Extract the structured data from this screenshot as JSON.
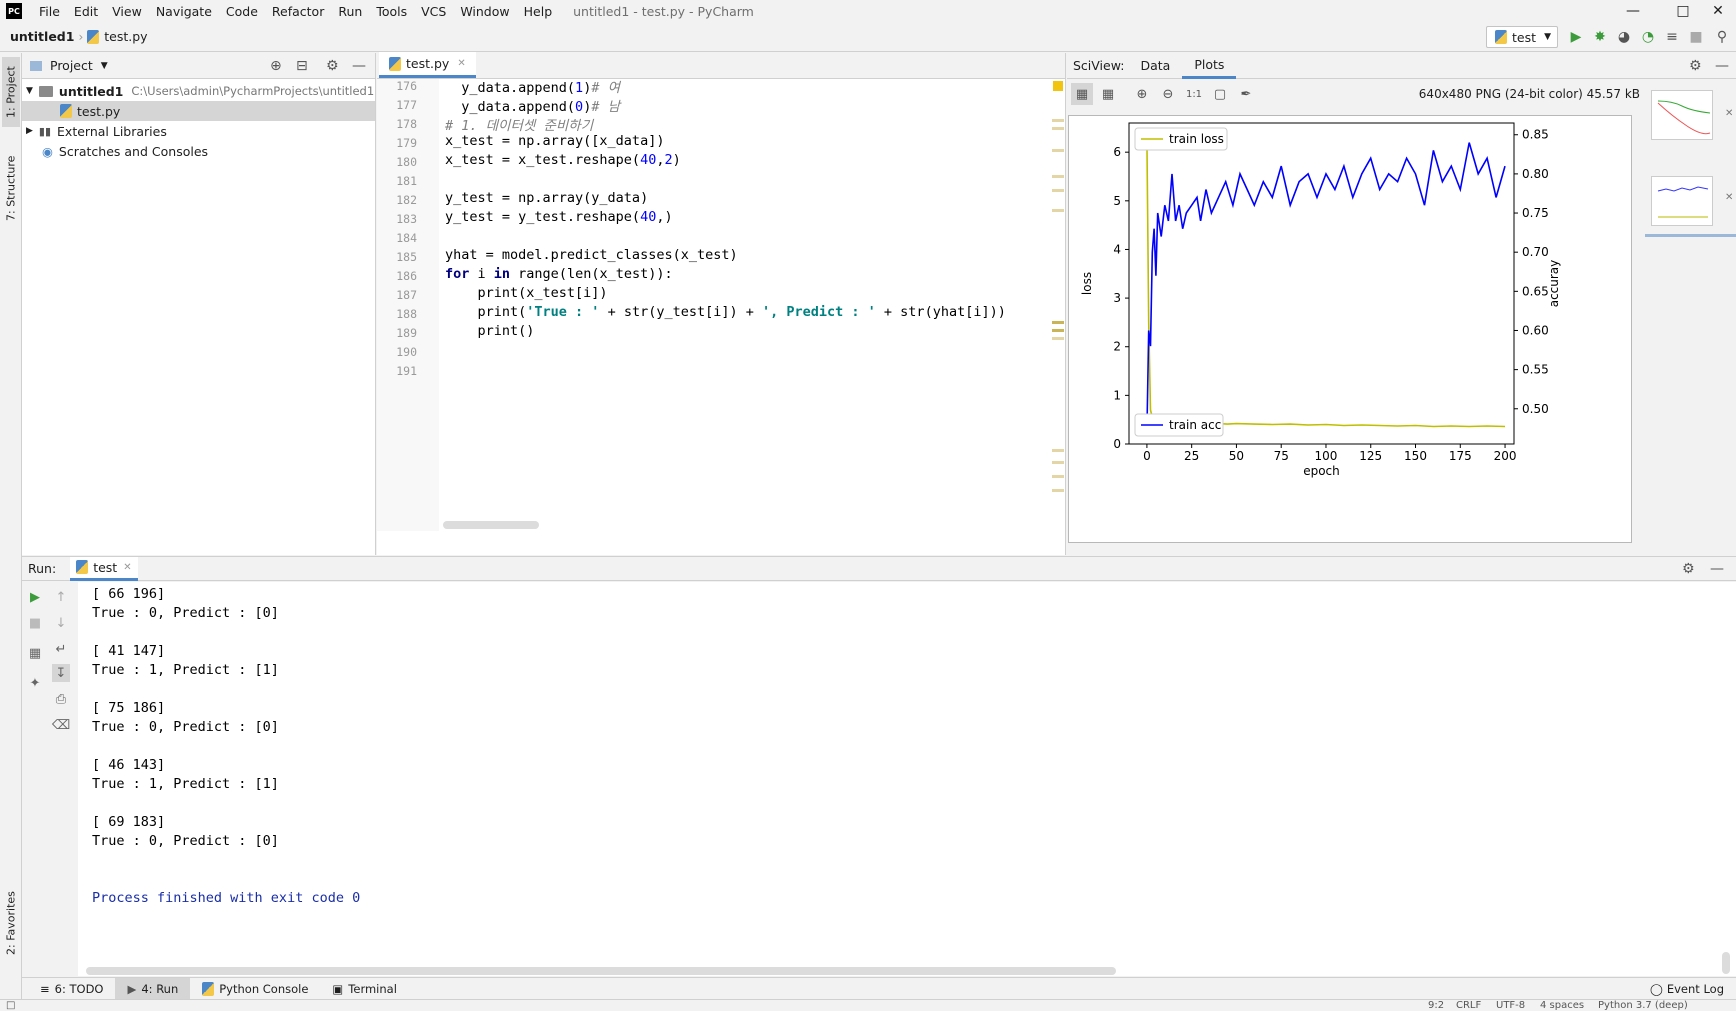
{
  "window": {
    "title": "untitled1 - test.py - PyCharm",
    "menu": [
      "File",
      "Edit",
      "View",
      "Navigate",
      "Code",
      "Refactor",
      "Run",
      "Tools",
      "VCS",
      "Window",
      "Help"
    ]
  },
  "nav": {
    "project": "untitled1",
    "file": "test.py",
    "run_config": "test"
  },
  "left_stripe": {
    "project_tab": "1: Project",
    "structure_tab": "7: Structure",
    "favorites_tab": "2: Favorites"
  },
  "project_panel": {
    "header": "Project",
    "tree": [
      {
        "label": "untitled1",
        "path": "C:\\Users\\admin\\PycharmProjects\\untitled1"
      },
      {
        "label": "test.py"
      },
      {
        "label": "External Libraries"
      },
      {
        "label": "Scratches and Consoles"
      }
    ]
  },
  "editor": {
    "tab": "test.py",
    "line_numbers": [
      "176",
      "177",
      "178",
      "179",
      "180",
      "181",
      "182",
      "183",
      "184",
      "185",
      "186",
      "187",
      "188",
      "189",
      "190",
      "191"
    ]
  },
  "sciview": {
    "label": "SciView:",
    "tabs": [
      "Data",
      "Plots"
    ],
    "image_info": "640x480 PNG (24-bit color) 45.57 kB",
    "zoom_label": "1:1"
  },
  "chart_data": {
    "type": "line",
    "title": "",
    "xlabel": "epoch",
    "ylabel": "loss",
    "y2label": "accuray",
    "xlim": [
      -10,
      205
    ],
    "ylim": [
      0,
      6.6
    ],
    "y2lim": [
      0.455,
      0.865
    ],
    "x_ticks": [
      0,
      25,
      50,
      75,
      100,
      125,
      150,
      175,
      200
    ],
    "y_ticks": [
      0,
      1,
      2,
      3,
      4,
      5,
      6
    ],
    "y2_ticks": [
      0.5,
      0.55,
      0.6,
      0.65,
      0.7,
      0.75,
      0.8,
      0.85
    ],
    "legend": [
      {
        "name": "train loss",
        "placement": "upper-left",
        "color": "#bfbf00"
      },
      {
        "name": "train acc",
        "placement": "lower-left",
        "color": "#0000ff"
      }
    ],
    "series": [
      {
        "name": "train loss",
        "axis": "left",
        "color": "#bfbf00",
        "x": [
          0,
          1,
          2,
          3,
          4,
          5,
          10,
          15,
          20,
          25,
          30,
          35,
          40,
          45,
          50,
          60,
          70,
          80,
          90,
          100,
          110,
          120,
          130,
          140,
          150,
          160,
          170,
          180,
          190,
          200
        ],
        "values": [
          6.3,
          2.5,
          0.7,
          0.55,
          0.52,
          0.5,
          0.48,
          0.46,
          0.45,
          0.44,
          0.43,
          0.42,
          0.42,
          0.41,
          0.42,
          0.41,
          0.4,
          0.41,
          0.39,
          0.4,
          0.38,
          0.39,
          0.38,
          0.37,
          0.38,
          0.36,
          0.37,
          0.36,
          0.37,
          0.36
        ]
      },
      {
        "name": "train acc",
        "axis": "right",
        "color": "#0000ff",
        "x": [
          0,
          1,
          2,
          3,
          4,
          5,
          6,
          8,
          10,
          12,
          14,
          16,
          18,
          20,
          22,
          25,
          28,
          30,
          33,
          36,
          40,
          44,
          48,
          52,
          56,
          60,
          65,
          70,
          75,
          80,
          85,
          90,
          95,
          100,
          105,
          110,
          115,
          120,
          125,
          130,
          135,
          140,
          145,
          150,
          155,
          160,
          165,
          170,
          175,
          180,
          185,
          190,
          195,
          200
        ],
        "values": [
          0.47,
          0.6,
          0.58,
          0.7,
          0.73,
          0.67,
          0.75,
          0.72,
          0.76,
          0.74,
          0.8,
          0.74,
          0.76,
          0.73,
          0.75,
          0.76,
          0.77,
          0.74,
          0.78,
          0.75,
          0.77,
          0.79,
          0.76,
          0.8,
          0.78,
          0.76,
          0.79,
          0.77,
          0.81,
          0.76,
          0.79,
          0.8,
          0.77,
          0.8,
          0.78,
          0.81,
          0.77,
          0.8,
          0.82,
          0.78,
          0.8,
          0.79,
          0.82,
          0.8,
          0.76,
          0.83,
          0.79,
          0.81,
          0.78,
          0.84,
          0.8,
          0.82,
          0.77,
          0.81
        ]
      }
    ]
  },
  "run_panel": {
    "label": "Run:",
    "tab": "test"
  },
  "console": {
    "lines": [
      "[ 66 196]",
      "True : 0, Predict : [0]",
      "",
      "[ 41 147]",
      "True : 1, Predict : [1]",
      "",
      "[ 75 186]",
      "True : 0, Predict : [0]",
      "",
      "[ 46 143]",
      "True : 1, Predict : [1]",
      "",
      "[ 69 183]",
      "True : 0, Predict : [0]",
      "",
      "",
      "Process finished with exit code 0"
    ]
  },
  "bottom_tabs": [
    "6: TODO",
    "4: Run",
    "Python Console",
    "Terminal"
  ],
  "event_log": "Event Log",
  "status": {
    "position": "9:2",
    "line_sep": "CRLF",
    "encoding": "UTF-8",
    "indent": "4 spaces",
    "interpreter": "Python 3.7 (deep)"
  },
  "colors": {
    "accent": "#4a86c8",
    "keyword": "#000080",
    "number": "#0000ff",
    "string": "#008080",
    "comment": "#808080",
    "run_green": "#3c9c3c"
  }
}
